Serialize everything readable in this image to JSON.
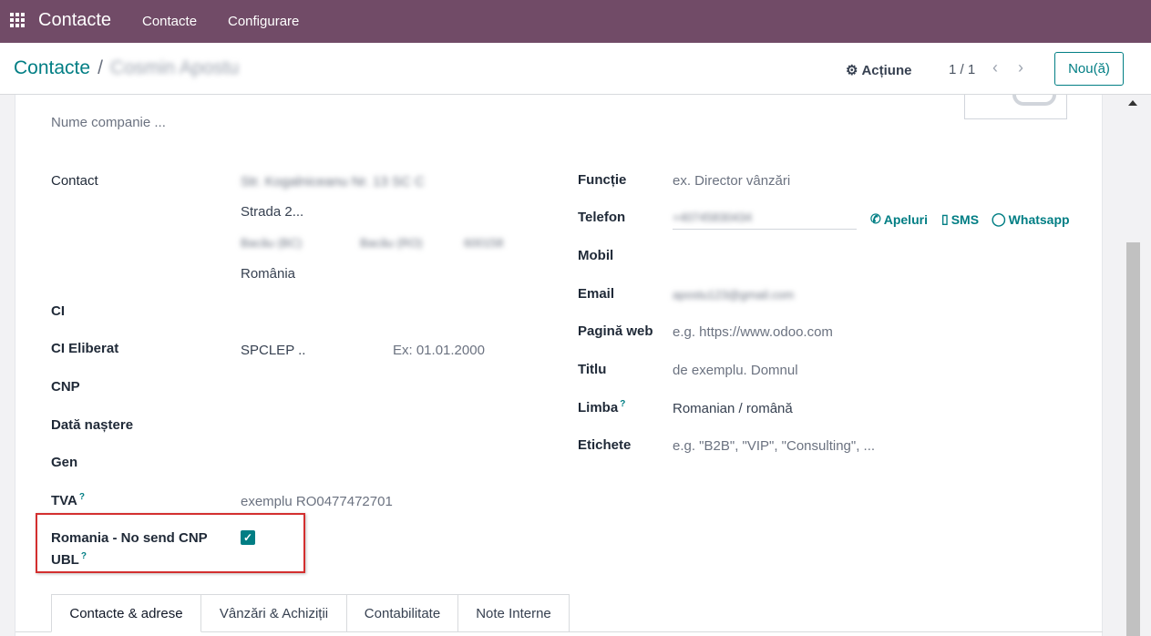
{
  "topbar": {
    "app_name": "Contacte",
    "menu": [
      "Contacte",
      "Configurare"
    ],
    "bg_color": "#714b67"
  },
  "control": {
    "breadcrumb_root": "Contacte",
    "breadcrumb_sep": "/",
    "breadcrumb_current": "Cosmin Apostu",
    "action_label": "Acțiune",
    "pager": "1 / 1",
    "new_button": "Nou(ă)"
  },
  "form": {
    "company_placeholder": "Nume companie ...",
    "left": {
      "contact_label": "Contact",
      "address_street_blurred": "Str. Kogalniceanu Nr. 13 SC C",
      "address_street2": "Strada 2...",
      "address_city_blurred": "Bacău (BC)",
      "address_state_blurred": "Bacău (RO)",
      "address_zip_blurred": "600158",
      "address_country": "România",
      "ci_label": "CI",
      "ci_eliberat_label": "CI Eliberat",
      "ci_eliberat_value": "SPCLEP ..",
      "ci_date_placeholder": "Ex: 01.01.2000",
      "cnp_label": "CNP",
      "birth_label": "Dată naștere",
      "gender_label": "Gen",
      "vat_label": "TVA",
      "vat_placeholder": "exemplu RO0477472701",
      "no_send_label_line1": "Romania - No send CNP",
      "no_send_label_line2": "UBL",
      "no_send_checked": true
    },
    "right": {
      "function_label": "Funcție",
      "function_placeholder": "ex. Director vânzări",
      "phone_label": "Telefon",
      "phone_value_blurred": "+40745830434",
      "call_link": "Apeluri",
      "sms_link": "SMS",
      "whatsapp_link": "Whatsapp",
      "mobile_label": "Mobil",
      "email_label": "Email",
      "email_value_blurred": "apostu123@gmail.com",
      "website_label": "Pagină web",
      "website_placeholder": "e.g. https://www.odoo.com",
      "title_label": "Titlu",
      "title_placeholder": "de exemplu. Domnul",
      "lang_label": "Limba",
      "lang_value": "Romanian / română",
      "tags_label": "Etichete",
      "tags_placeholder": "e.g. \"B2B\", \"VIP\", \"Consulting\", ..."
    },
    "help_mark": "?"
  },
  "tabs": [
    "Contacte & adrese",
    "Vânzări & Achiziții",
    "Contabilitate",
    "Note Interne"
  ],
  "accent_color": "#017e84",
  "highlight_color": "#d32f2f"
}
